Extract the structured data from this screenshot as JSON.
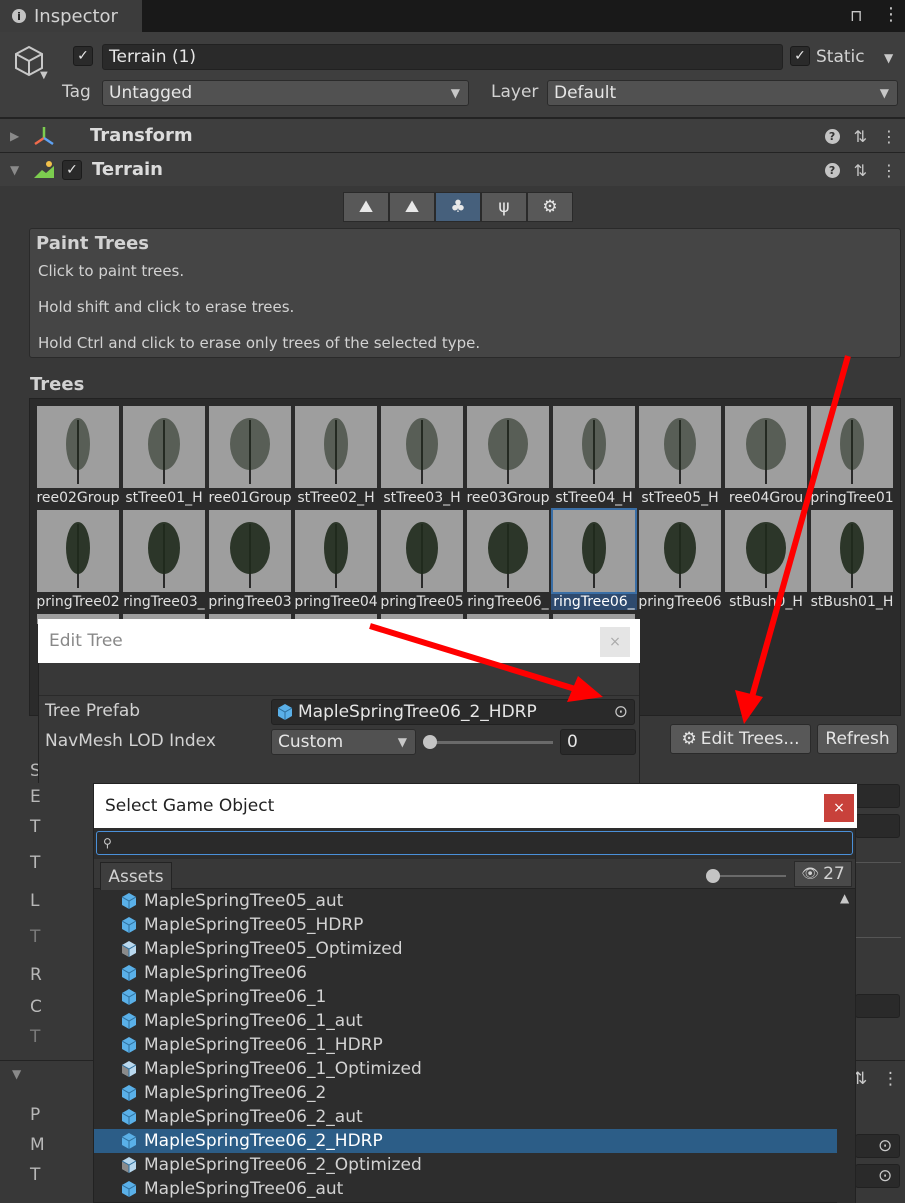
{
  "inspector_tab": {
    "title": "Inspector"
  },
  "object": {
    "name": "Terrain (1)",
    "static_label": "Static",
    "tag_label": "Tag",
    "tag_value": "Untagged",
    "layer_label": "Layer",
    "layer_value": "Default"
  },
  "components": {
    "transform": "Transform",
    "terrain": "Terrain"
  },
  "paint_trees": {
    "heading": "Paint Trees",
    "line1": "Click to paint trees.",
    "line2": "Hold shift and click to erase trees.",
    "line3": "Hold Ctrl and click to erase only trees of the selected type."
  },
  "trees": {
    "heading": "Trees",
    "row1": [
      "ree02Group",
      "stTree01_H",
      "ree01Group",
      "stTree02_H",
      "stTree03_H",
      "ree03Group",
      "stTree04_H",
      "stTree05_H",
      "ree04Grou",
      "pringTree01"
    ],
    "row2": [
      "pringTree02",
      "ringTree03_",
      "pringTree03",
      "pringTree04",
      "pringTree05",
      "ringTree06_",
      "ringTree06_",
      "pringTree06",
      "stBush0_H",
      "stBush01_H"
    ],
    "selected_index": 6
  },
  "buttons": {
    "edit_trees": "Edit Trees...",
    "refresh": "Refresh"
  },
  "edit_tree": {
    "title": "Edit Tree",
    "close": "×",
    "prefab_label": "Tree Prefab",
    "prefab_value": "MapleSpringTree06_2_HDRP",
    "lod_label": "NavMesh LOD Index",
    "lod_value": "Custom",
    "lod_number": "0",
    "lod_slider_fraction": 0.0
  },
  "select_game_object": {
    "title": "Select Game Object",
    "close": "×",
    "search_value": "",
    "assets_tab": "Assets",
    "count": "27",
    "items": [
      {
        "name": "MapleSpringTree05_aut",
        "icon": "prefab-icon"
      },
      {
        "name": "MapleSpringTree05_HDRP",
        "icon": "prefab-icon"
      },
      {
        "name": "MapleSpringTree05_Optimized",
        "icon": "model-prefab-icon"
      },
      {
        "name": "MapleSpringTree06",
        "icon": "prefab-icon"
      },
      {
        "name": "MapleSpringTree06_1",
        "icon": "prefab-icon"
      },
      {
        "name": "MapleSpringTree06_1_aut",
        "icon": "prefab-icon"
      },
      {
        "name": "MapleSpringTree06_1_HDRP",
        "icon": "prefab-icon"
      },
      {
        "name": "MapleSpringTree06_1_Optimized",
        "icon": "model-prefab-icon"
      },
      {
        "name": "MapleSpringTree06_2",
        "icon": "prefab-icon"
      },
      {
        "name": "MapleSpringTree06_2_aut",
        "icon": "prefab-icon"
      },
      {
        "name": "MapleSpringTree06_2_HDRP",
        "icon": "prefab-icon",
        "selected": true
      },
      {
        "name": "MapleSpringTree06_2_Optimized",
        "icon": "model-prefab-icon"
      },
      {
        "name": "MapleSpringTree06_aut",
        "icon": "prefab-icon"
      }
    ]
  },
  "colors": {
    "selection": "#2c5d87",
    "arrow": "#ff0000",
    "prefab_blue": "#5ab0e8"
  }
}
